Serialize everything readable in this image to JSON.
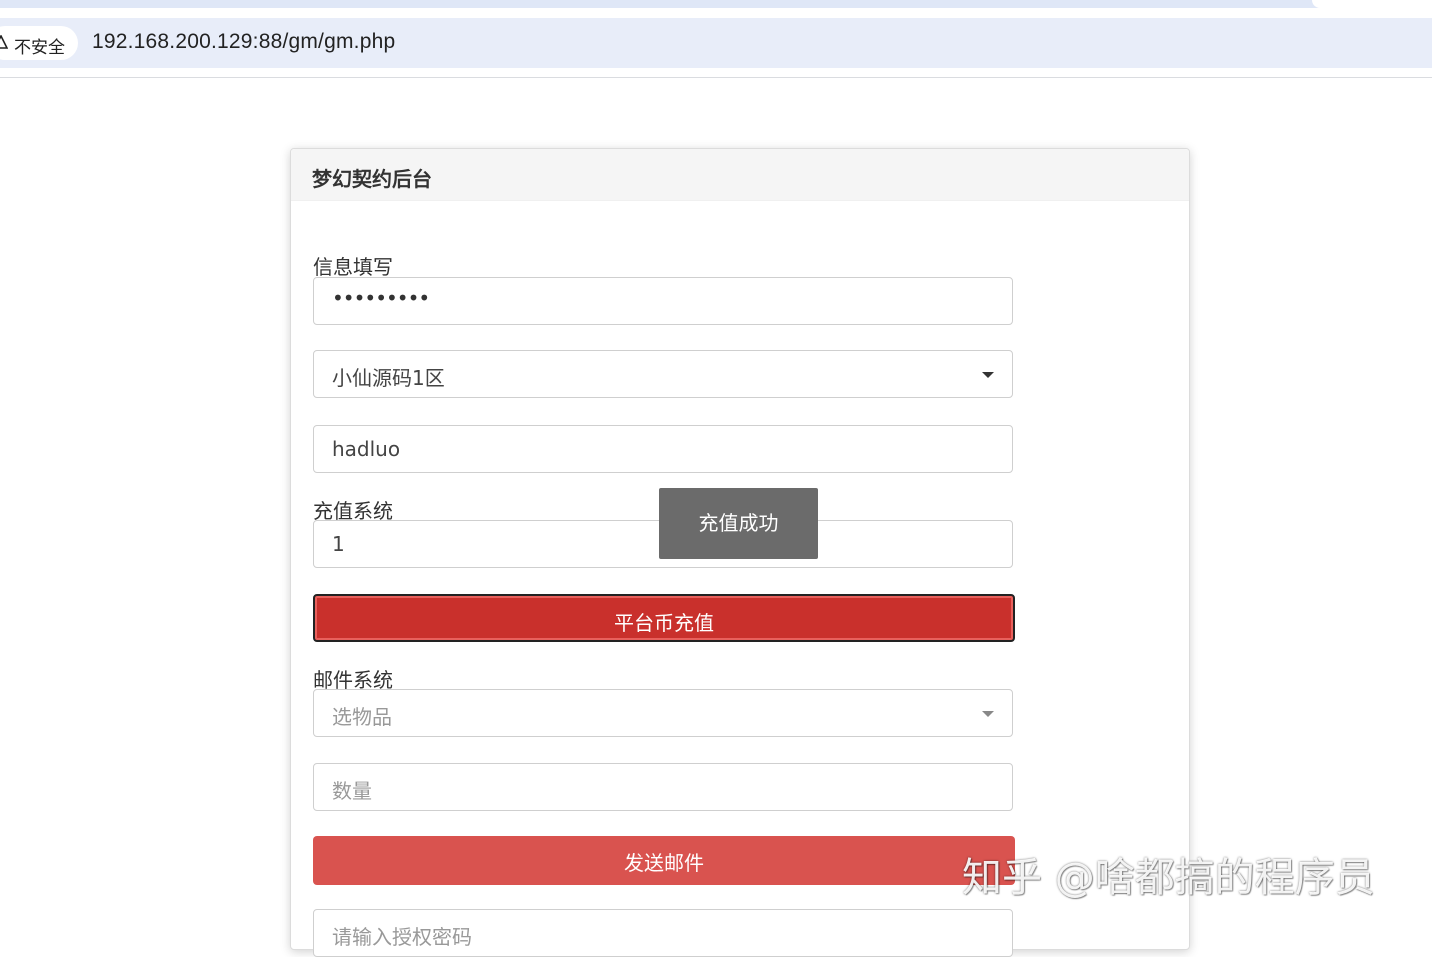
{
  "browser": {
    "security_label": "不安全",
    "url": "192.168.200.129:88/gm/gm.php"
  },
  "panel": {
    "title": "梦幻契约后台",
    "info_section_label": "信息填写",
    "password_value": "•••••••••",
    "server_select_value": "小仙源码1区",
    "account_value": "hadluo",
    "recharge_section_label": "充值系统",
    "recharge_amount_value": "1",
    "recharge_button_label": "平台币充值",
    "mail_section_label": "邮件系统",
    "item_select_placeholder": "选物品",
    "quantity_placeholder": "数量",
    "send_mail_button_label": "发送邮件",
    "auth_password_placeholder": "请输入授权密码"
  },
  "toast": {
    "message": "充值成功"
  },
  "watermark": {
    "text": "知乎 @啥都搞的程序员"
  },
  "colors": {
    "recharge_button": "#c9302c",
    "send_mail_button": "#d9534f",
    "toast_background": "#6b6b6b",
    "address_bar": "#e8edf9"
  }
}
